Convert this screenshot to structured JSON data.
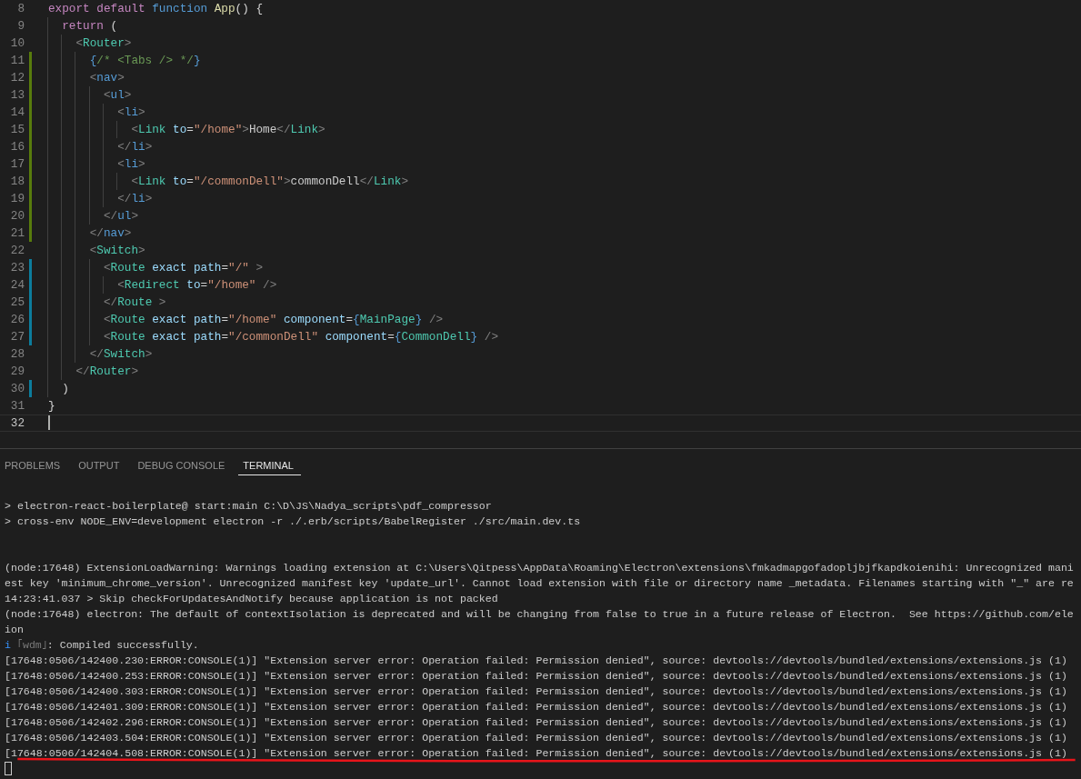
{
  "editor": {
    "lines": [
      {
        "number": "8",
        "added": false,
        "modified": false,
        "current": false,
        "tokens": [
          {
            "kind": "keyword",
            "text": "export default"
          },
          {
            "kind": "storage",
            "text": " function"
          },
          {
            "kind": "func",
            "text": " App"
          },
          {
            "kind": "punct",
            "text": "() {"
          }
        ]
      },
      {
        "number": "9",
        "added": false,
        "modified": false,
        "current": false,
        "tokens": [
          {
            "kind": "keyword",
            "text": "  return"
          },
          {
            "kind": "punct",
            "text": " ("
          }
        ]
      },
      {
        "number": "10",
        "added": false,
        "modified": false,
        "current": false,
        "tokens": [
          {
            "kind": "bracket",
            "text": "    <"
          },
          {
            "kind": "tag",
            "text": "Router"
          },
          {
            "kind": "bracket",
            "text": ">"
          }
        ]
      },
      {
        "number": "11",
        "added": true,
        "modified": false,
        "current": false,
        "tokens": [
          {
            "kind": "storage",
            "text": "      {"
          },
          {
            "kind": "comment",
            "text": "/* <Tabs /> */"
          },
          {
            "kind": "storage",
            "text": "}"
          }
        ]
      },
      {
        "number": "12",
        "added": true,
        "modified": false,
        "current": false,
        "tokens": [
          {
            "kind": "bracket",
            "text": "      <"
          },
          {
            "kind": "storage",
            "text": "nav"
          },
          {
            "kind": "bracket",
            "text": ">"
          }
        ]
      },
      {
        "number": "13",
        "added": true,
        "modified": false,
        "current": false,
        "tokens": [
          {
            "kind": "bracket",
            "text": "        <"
          },
          {
            "kind": "storage",
            "text": "ul"
          },
          {
            "kind": "bracket",
            "text": ">"
          }
        ]
      },
      {
        "number": "14",
        "added": true,
        "modified": false,
        "current": false,
        "tokens": [
          {
            "kind": "bracket",
            "text": "          <"
          },
          {
            "kind": "storage",
            "text": "li"
          },
          {
            "kind": "bracket",
            "text": ">"
          }
        ]
      },
      {
        "number": "15",
        "added": true,
        "modified": false,
        "current": false,
        "tokens": [
          {
            "kind": "bracket",
            "text": "            <"
          },
          {
            "kind": "tag",
            "text": "Link"
          },
          {
            "kind": "attr",
            "text": " to"
          },
          {
            "kind": "punct",
            "text": "="
          },
          {
            "kind": "string",
            "text": "\"/home\""
          },
          {
            "kind": "bracket",
            "text": ">"
          },
          {
            "kind": "plain",
            "text": "Home"
          },
          {
            "kind": "bracket",
            "text": "</"
          },
          {
            "kind": "tag",
            "text": "Link"
          },
          {
            "kind": "bracket",
            "text": ">"
          }
        ]
      },
      {
        "number": "16",
        "added": true,
        "modified": false,
        "current": false,
        "tokens": [
          {
            "kind": "bracket",
            "text": "          </"
          },
          {
            "kind": "storage",
            "text": "li"
          },
          {
            "kind": "bracket",
            "text": ">"
          }
        ]
      },
      {
        "number": "17",
        "added": true,
        "modified": false,
        "current": false,
        "tokens": [
          {
            "kind": "bracket",
            "text": "          <"
          },
          {
            "kind": "storage",
            "text": "li"
          },
          {
            "kind": "bracket",
            "text": ">"
          }
        ]
      },
      {
        "number": "18",
        "added": true,
        "modified": false,
        "current": false,
        "tokens": [
          {
            "kind": "bracket",
            "text": "            <"
          },
          {
            "kind": "tag",
            "text": "Link"
          },
          {
            "kind": "attr",
            "text": " to"
          },
          {
            "kind": "punct",
            "text": "="
          },
          {
            "kind": "string",
            "text": "\"/commonDell\""
          },
          {
            "kind": "bracket",
            "text": ">"
          },
          {
            "kind": "plain",
            "text": "commonDell"
          },
          {
            "kind": "bracket",
            "text": "</"
          },
          {
            "kind": "tag",
            "text": "Link"
          },
          {
            "kind": "bracket",
            "text": ">"
          }
        ]
      },
      {
        "number": "19",
        "added": true,
        "modified": false,
        "current": false,
        "tokens": [
          {
            "kind": "bracket",
            "text": "          </"
          },
          {
            "kind": "storage",
            "text": "li"
          },
          {
            "kind": "bracket",
            "text": ">"
          }
        ]
      },
      {
        "number": "20",
        "added": true,
        "modified": false,
        "current": false,
        "tokens": [
          {
            "kind": "bracket",
            "text": "        </"
          },
          {
            "kind": "storage",
            "text": "ul"
          },
          {
            "kind": "bracket",
            "text": ">"
          }
        ]
      },
      {
        "number": "21",
        "added": true,
        "modified": false,
        "current": false,
        "tokens": [
          {
            "kind": "bracket",
            "text": "      </"
          },
          {
            "kind": "storage",
            "text": "nav"
          },
          {
            "kind": "bracket",
            "text": ">"
          }
        ]
      },
      {
        "number": "22",
        "added": false,
        "modified": false,
        "current": false,
        "tokens": [
          {
            "kind": "bracket",
            "text": "      <"
          },
          {
            "kind": "tag",
            "text": "Switch"
          },
          {
            "kind": "bracket",
            "text": ">"
          }
        ]
      },
      {
        "number": "23",
        "added": false,
        "modified": true,
        "current": false,
        "tokens": [
          {
            "kind": "bracket",
            "text": "        <"
          },
          {
            "kind": "tag",
            "text": "Route"
          },
          {
            "kind": "attr",
            "text": " exact path"
          },
          {
            "kind": "punct",
            "text": "="
          },
          {
            "kind": "string",
            "text": "\"/\""
          },
          {
            "kind": "bracket",
            "text": " >"
          }
        ]
      },
      {
        "number": "24",
        "added": false,
        "modified": true,
        "current": false,
        "tokens": [
          {
            "kind": "bracket",
            "text": "          <"
          },
          {
            "kind": "tag",
            "text": "Redirect"
          },
          {
            "kind": "attr",
            "text": " to"
          },
          {
            "kind": "punct",
            "text": "="
          },
          {
            "kind": "string",
            "text": "\"/home\""
          },
          {
            "kind": "bracket",
            "text": " />"
          }
        ]
      },
      {
        "number": "25",
        "added": false,
        "modified": true,
        "current": false,
        "tokens": [
          {
            "kind": "bracket",
            "text": "        </"
          },
          {
            "kind": "tag",
            "text": "Route"
          },
          {
            "kind": "bracket",
            "text": " >"
          }
        ]
      },
      {
        "number": "26",
        "added": false,
        "modified": true,
        "current": false,
        "tokens": [
          {
            "kind": "bracket",
            "text": "        <"
          },
          {
            "kind": "tag",
            "text": "Route"
          },
          {
            "kind": "attr",
            "text": " exact path"
          },
          {
            "kind": "punct",
            "text": "="
          },
          {
            "kind": "string",
            "text": "\"/home\""
          },
          {
            "kind": "attr",
            "text": " component"
          },
          {
            "kind": "punct",
            "text": "="
          },
          {
            "kind": "storage",
            "text": "{"
          },
          {
            "kind": "tag",
            "text": "MainPage"
          },
          {
            "kind": "storage",
            "text": "}"
          },
          {
            "kind": "bracket",
            "text": " />"
          }
        ]
      },
      {
        "number": "27",
        "added": false,
        "modified": true,
        "current": false,
        "tokens": [
          {
            "kind": "bracket",
            "text": "        <"
          },
          {
            "kind": "tag",
            "text": "Route"
          },
          {
            "kind": "attr",
            "text": " exact path"
          },
          {
            "kind": "punct",
            "text": "="
          },
          {
            "kind": "string",
            "text": "\"/commonDell\""
          },
          {
            "kind": "attr",
            "text": " component"
          },
          {
            "kind": "punct",
            "text": "="
          },
          {
            "kind": "storage",
            "text": "{"
          },
          {
            "kind": "tag",
            "text": "CommonDell"
          },
          {
            "kind": "storage",
            "text": "}"
          },
          {
            "kind": "bracket",
            "text": " />"
          }
        ]
      },
      {
        "number": "28",
        "added": false,
        "modified": false,
        "current": false,
        "tokens": [
          {
            "kind": "bracket",
            "text": "      </"
          },
          {
            "kind": "tag",
            "text": "Switch"
          },
          {
            "kind": "bracket",
            "text": ">"
          }
        ]
      },
      {
        "number": "29",
        "added": false,
        "modified": false,
        "current": false,
        "tokens": [
          {
            "kind": "bracket",
            "text": "    </"
          },
          {
            "kind": "tag",
            "text": "Router"
          },
          {
            "kind": "bracket",
            "text": ">"
          }
        ]
      },
      {
        "number": "30",
        "added": false,
        "modified": true,
        "current": false,
        "tokens": [
          {
            "kind": "punct",
            "text": "  )"
          }
        ]
      },
      {
        "number": "31",
        "added": false,
        "modified": false,
        "current": false,
        "tokens": [
          {
            "kind": "punct",
            "text": "}"
          }
        ]
      },
      {
        "number": "32",
        "added": false,
        "modified": false,
        "current": true
      }
    ]
  },
  "panel": {
    "tabs": [
      {
        "label": "PROBLEMS",
        "selected": false
      },
      {
        "label": "OUTPUT",
        "selected": false
      },
      {
        "label": "DEBUG CONSOLE",
        "selected": false
      },
      {
        "label": "TERMINAL",
        "selected": true
      }
    ],
    "terminal": {
      "blocks": [
        [
          {
            "tokens": [
              {
                "kind": "plain",
                "text": "> electron-react-boilerplate@ start:main C:\\D\\JS\\Nadya_scripts\\pdf_compressor"
              }
            ]
          },
          {
            "tokens": [
              {
                "kind": "plain",
                "text": "> cross-env NODE_ENV=development electron -r ./.erb/scripts/BabelRegister ./src/main.dev.ts"
              }
            ]
          }
        ],
        [
          {
            "tokens": [
              {
                "kind": "plain",
                "text": "(node:17648) ExtensionLoadWarning: Warnings loading extension at C:\\Users\\Qitpess\\AppData\\Roaming\\Electron\\extensions\\fmkadmapgofadopljbjfkapdkoienihi: Unrecognized mani"
              }
            ]
          },
          {
            "tokens": [
              {
                "kind": "plain",
                "text": "est key 'minimum_chrome_version'. Unrecognized manifest key 'update_url'. Cannot load extension with file or directory name _metadata. Filenames starting with \"_\" are re"
              }
            ]
          },
          {
            "tokens": [
              {
                "kind": "plain",
                "text": "14:23:41.037 > Skip checkForUpdatesAndNotify because application is not packed"
              }
            ]
          },
          {
            "tokens": [
              {
                "kind": "plain",
                "text": "(node:17648) electron: The default of contextIsolation is deprecated and will be changing from false to true in a future release of Electron.  See https://github.com/ele"
              }
            ]
          },
          {
            "tokens": [
              {
                "kind": "plain",
                "text": "ion"
              }
            ]
          },
          {
            "tokens": [
              {
                "kind": "info",
                "text": "i"
              },
              {
                "kind": "dim",
                "text": " ｢wdm｣"
              },
              {
                "kind": "plain",
                "text": ": Compiled successfully."
              }
            ]
          },
          {
            "tokens": [
              {
                "kind": "plain",
                "text": "[17648:0506/142400.230:ERROR:CONSOLE(1)] \"Extension server error: Operation failed: Permission denied\", source: devtools://devtools/bundled/extensions/extensions.js (1)"
              }
            ]
          },
          {
            "tokens": [
              {
                "kind": "plain",
                "text": "[17648:0506/142400.253:ERROR:CONSOLE(1)] \"Extension server error: Operation failed: Permission denied\", source: devtools://devtools/bundled/extensions/extensions.js (1)"
              }
            ]
          },
          {
            "tokens": [
              {
                "kind": "plain",
                "text": "[17648:0506/142400.303:ERROR:CONSOLE(1)] \"Extension server error: Operation failed: Permission denied\", source: devtools://devtools/bundled/extensions/extensions.js (1)"
              }
            ]
          },
          {
            "tokens": [
              {
                "kind": "plain",
                "text": "[17648:0506/142401.309:ERROR:CONSOLE(1)] \"Extension server error: Operation failed: Permission denied\", source: devtools://devtools/bundled/extensions/extensions.js (1)"
              }
            ]
          },
          {
            "tokens": [
              {
                "kind": "plain",
                "text": "[17648:0506/142402.296:ERROR:CONSOLE(1)] \"Extension server error: Operation failed: Permission denied\", source: devtools://devtools/bundled/extensions/extensions.js (1)"
              }
            ]
          },
          {
            "tokens": [
              {
                "kind": "plain",
                "text": "[17648:0506/142403.504:ERROR:CONSOLE(1)] \"Extension server error: Operation failed: Permission denied\", source: devtools://devtools/bundled/extensions/extensions.js (1)"
              }
            ]
          },
          {
            "tokens": [
              {
                "kind": "plain",
                "text": "[17648:0506/142404.508:ERROR:CONSOLE(1)] \"Extension server error: Operation failed: Permission denied\", source: devtools://devtools/bundled/extensions/extensions.js (1)",
                "underlined": true
              }
            ]
          }
        ]
      ]
    }
  }
}
